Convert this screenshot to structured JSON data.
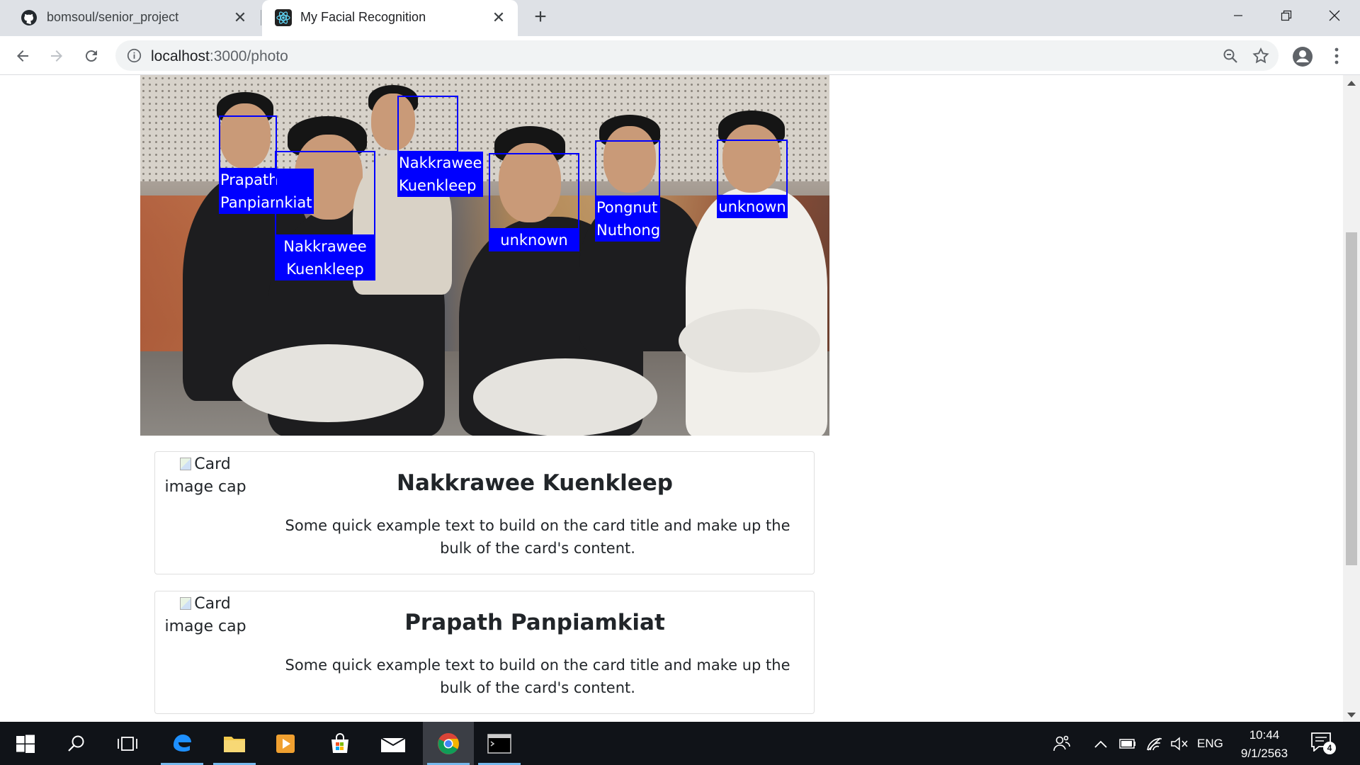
{
  "browser": {
    "tabs": [
      {
        "title": "bomsoul/senior_project",
        "icon": "github-icon",
        "active": false
      },
      {
        "title": "My Facial Recognition",
        "icon": "react-icon",
        "active": true
      }
    ],
    "new_tab": "+",
    "close_glyph": "✕",
    "url_host": "localhost",
    "url_rest": ":3000/photo"
  },
  "photo": {
    "faces": [
      {
        "name": "Prapath Panpiamkiat",
        "line1": "Prapath",
        "line2": "Panpiamkiat"
      },
      {
        "name": "Nakkrawee Kuenkleep",
        "line1": "Nakkrawee",
        "line2": "Kuenkleep"
      },
      {
        "name": "Nakkrawee Kuenkleep",
        "line1": "Nakkrawee",
        "line2": "Kuenkleep"
      },
      {
        "name": "unknown",
        "line1": "unknown",
        "line2": ""
      },
      {
        "name": "Pongnut Nuthong",
        "line1": "Pongnut",
        "line2": "Nuthong"
      },
      {
        "name": "unknown",
        "line1": "unknown",
        "line2": ""
      }
    ]
  },
  "cards": [
    {
      "img_alt": "Card image cap",
      "title": "Nakkrawee Kuenkleep",
      "text": "Some quick example text to build on the card title and make up the bulk of the card's content."
    },
    {
      "img_alt": "Card image cap",
      "title": "Prapath Panpiamkiat",
      "text": "Some quick example text to build on the card title and make up the bulk of the card's content."
    }
  ],
  "taskbar": {
    "apps": [
      "start-icon",
      "search-icon",
      "task-view-icon",
      "edge-icon",
      "file-explorer-icon",
      "media-player-icon",
      "store-icon",
      "mail-icon",
      "chrome-icon",
      "terminal-icon"
    ],
    "language": "ENG",
    "time": "10:44",
    "date": "9/1/2563",
    "notification_count": "4"
  },
  "colors": {
    "box": "#0000ff",
    "tabstrip": "#dee1e6",
    "taskbar": "#101318"
  }
}
